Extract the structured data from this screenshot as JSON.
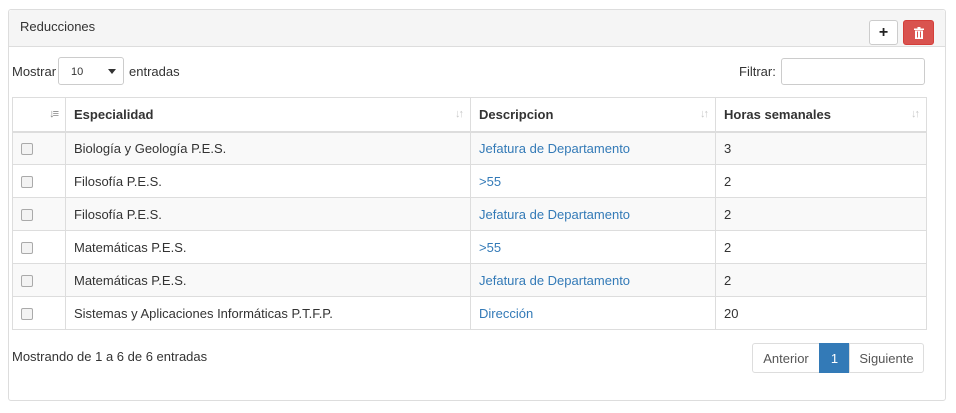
{
  "panel": {
    "title": "Reducciones"
  },
  "toolbar": {
    "add_icon": "plus-icon",
    "delete_icon": "trash-icon",
    "delete_color": "#d9534f"
  },
  "length": {
    "label": "Mostrar",
    "value": "10",
    "suffix": "entradas"
  },
  "filter": {
    "label": "Filtrar:",
    "value": ""
  },
  "table": {
    "columns": [
      "",
      "Especialidad",
      "Descripcion",
      "Horas semanales"
    ],
    "rows": [
      {
        "especialidad": "Biología y Geología P.E.S.",
        "descripcion": "Jefatura de Departamento",
        "horas": "3"
      },
      {
        "especialidad": "Filosofía P.E.S.",
        "descripcion": ">55",
        "horas": "2"
      },
      {
        "especialidad": "Filosofía P.E.S.",
        "descripcion": "Jefatura de Departamento",
        "horas": "2"
      },
      {
        "especialidad": "Matemáticas P.E.S.",
        "descripcion": ">55",
        "horas": "2"
      },
      {
        "especialidad": "Matemáticas P.E.S.",
        "descripcion": "Jefatura de Departamento",
        "horas": "2"
      },
      {
        "especialidad": "Sistemas y Aplicaciones Informáticas P.T.F.P.",
        "descripcion": "Dirección",
        "horas": "20"
      }
    ]
  },
  "footer": {
    "info": "Mostrando de 1 a 6 de 6 entradas",
    "prev": "Anterior",
    "page": "1",
    "next": "Siguiente"
  },
  "colors": {
    "link": "#337ab7",
    "active_page": "#337ab7"
  }
}
